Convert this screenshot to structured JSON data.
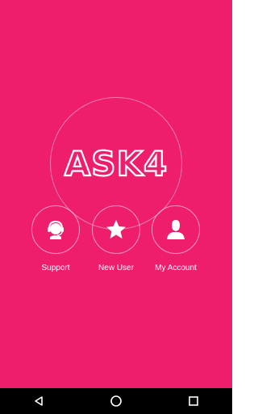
{
  "app": {
    "logo_text": "ASK4"
  },
  "actions": [
    {
      "label": "Support",
      "icon": "support-agent-icon"
    },
    {
      "label": "New User",
      "icon": "star-icon"
    },
    {
      "label": "My Account",
      "icon": "user-icon"
    }
  ],
  "navbar": {
    "back_icon": "back-triangle-icon",
    "home_icon": "home-circle-icon",
    "recents_icon": "recents-square-icon"
  },
  "colors": {
    "background": "#EF1E6C",
    "foreground": "#FFFFFF",
    "navbar": "#000000"
  }
}
